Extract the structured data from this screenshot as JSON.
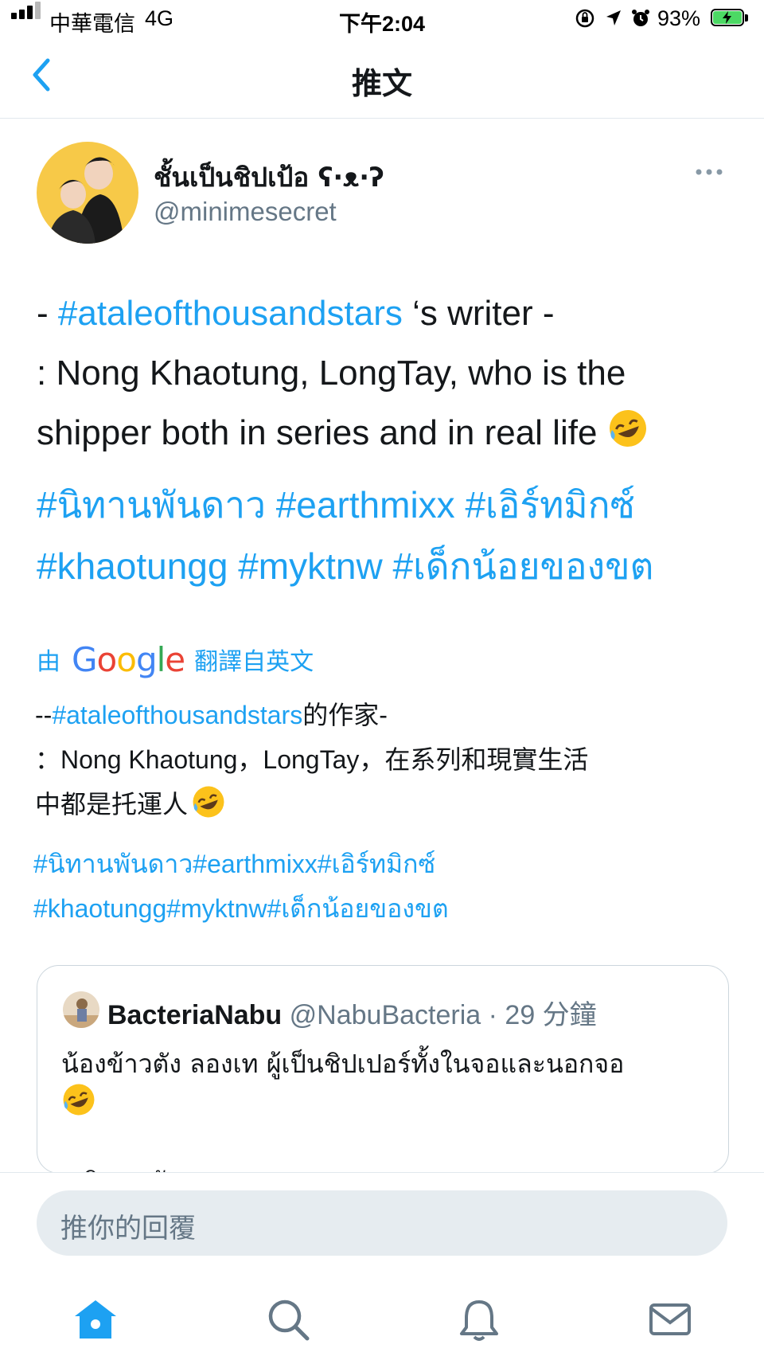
{
  "status_bar": {
    "carrier": "中華電信",
    "network": "4G",
    "time": "下午2:04",
    "battery": "93%"
  },
  "nav": {
    "title": "推文"
  },
  "tweet": {
    "author_name": "ชั้นเป็นชิปเป้อ ʕ·ᴥ·ʔ",
    "handle": "@minimesecret",
    "body_prefix": "- ",
    "body_hashtag": "#ataleofthousandstars",
    "body_line1_rest": " ‘s writer -",
    "body_line2": ": Nong Khaotung, LongTay, who is the",
    "body_line3": "shipper both in series and in real life",
    "tags_line1": "#นิทานพันดาว #earthmixx #เอิร์ทมิกซ์",
    "tags_line2": "#khaotungg #myktnw #เด็กน้อยของขต"
  },
  "translation": {
    "prefix": "由",
    "google_letters": [
      "G",
      "o",
      "o",
      "g",
      "l",
      "e"
    ],
    "google_colors": [
      "#4285f4",
      "#ea4335",
      "#fbbc05",
      "#4285f4",
      "#34a853",
      "#ea4335"
    ],
    "suffix": "翻譯自英文",
    "line1_prefix": "--",
    "line1_hashtag": "#ataleofthousandstars",
    "line1_rest": "的作家-",
    "line2": "：Nong Khaotung，LongTay，在系列和現實生活",
    "line3": "中都是托運人",
    "tags_line1": "#นิทานพันดาว#earthmixx#เอิร์ทมิกซ์",
    "tags_line2": "#khaotungg#myktnw#เด็กน้อยของขต"
  },
  "quote": {
    "name": "BacteriaNabu",
    "handle": "@NabuBacteria",
    "time": "· 29 分鐘",
    "text": "น้องข้าวตัง ลองเท ผู้เป็นชิปเปอร์ทั้งในจอและนอกจอ",
    "partial_line": "#นิทานพันดาว"
  },
  "reply": {
    "placeholder": "推你的回覆"
  },
  "tabs": [
    "home-icon",
    "search-icon",
    "notifications-icon",
    "messages-icon"
  ],
  "colors": {
    "accent": "#1da1f2",
    "text": "#14171a",
    "secondary": "#657786",
    "reply_bg": "#e6ecf0",
    "avatar_bg": "#f7c948",
    "battery_green": "#4cd964"
  }
}
